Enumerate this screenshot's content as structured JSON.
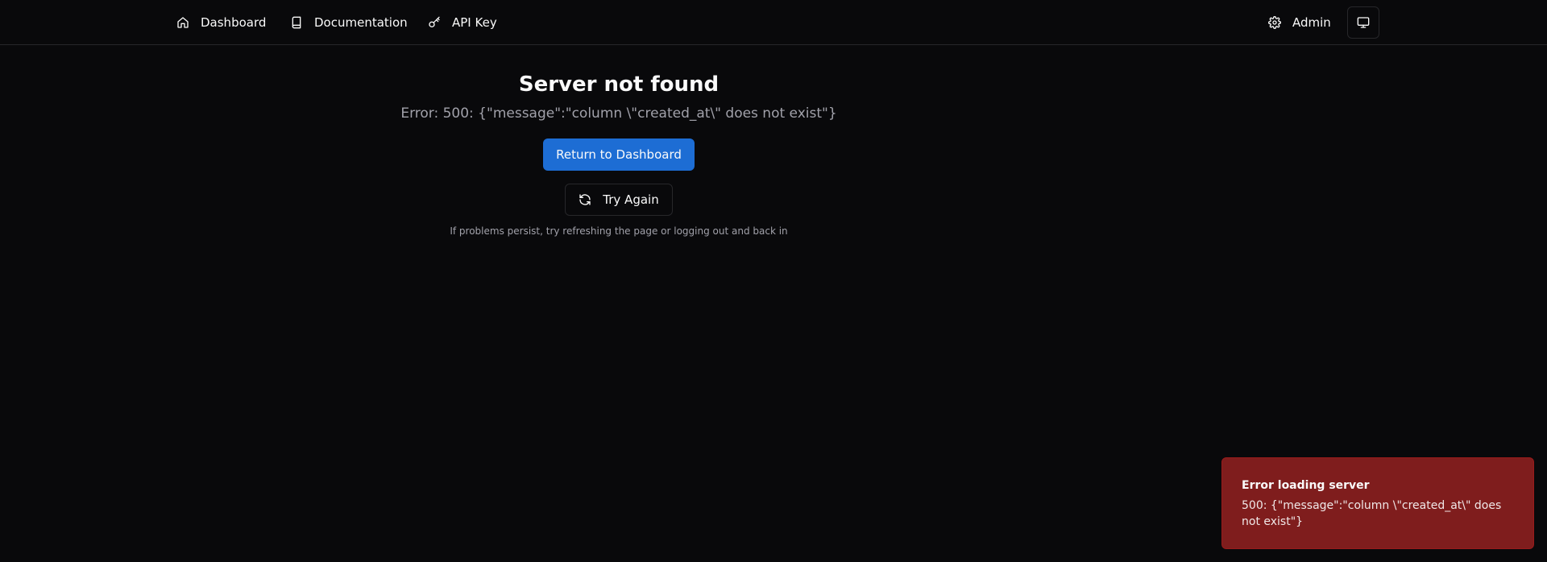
{
  "nav": {
    "dashboard": "Dashboard",
    "documentation": "Documentation",
    "api_key": "API Key",
    "admin": "Admin"
  },
  "icons": {
    "dashboard": "home-icon",
    "documentation": "book-icon",
    "api_key": "key-icon",
    "admin": "gear-icon",
    "theme": "monitor-icon",
    "try_again": "refresh-icon"
  },
  "main": {
    "title": "Server not found",
    "error": "Error: 500: {\"message\":\"column \\\"created_at\\\" does not exist\"}",
    "return_button": "Return to Dashboard",
    "try_again_button": "Try Again",
    "hint": "If problems persist, try refreshing the page or logging out and back in"
  },
  "toast": {
    "title": "Error loading server",
    "description": "500: {\"message\":\"column \\\"created_at\\\" does not exist\"}"
  },
  "colors": {
    "background": "#09090b",
    "primary": "#1d6dd4",
    "toast_bg": "#7f1d1d",
    "muted_text": "#a1a1aa",
    "border": "#27272a"
  }
}
